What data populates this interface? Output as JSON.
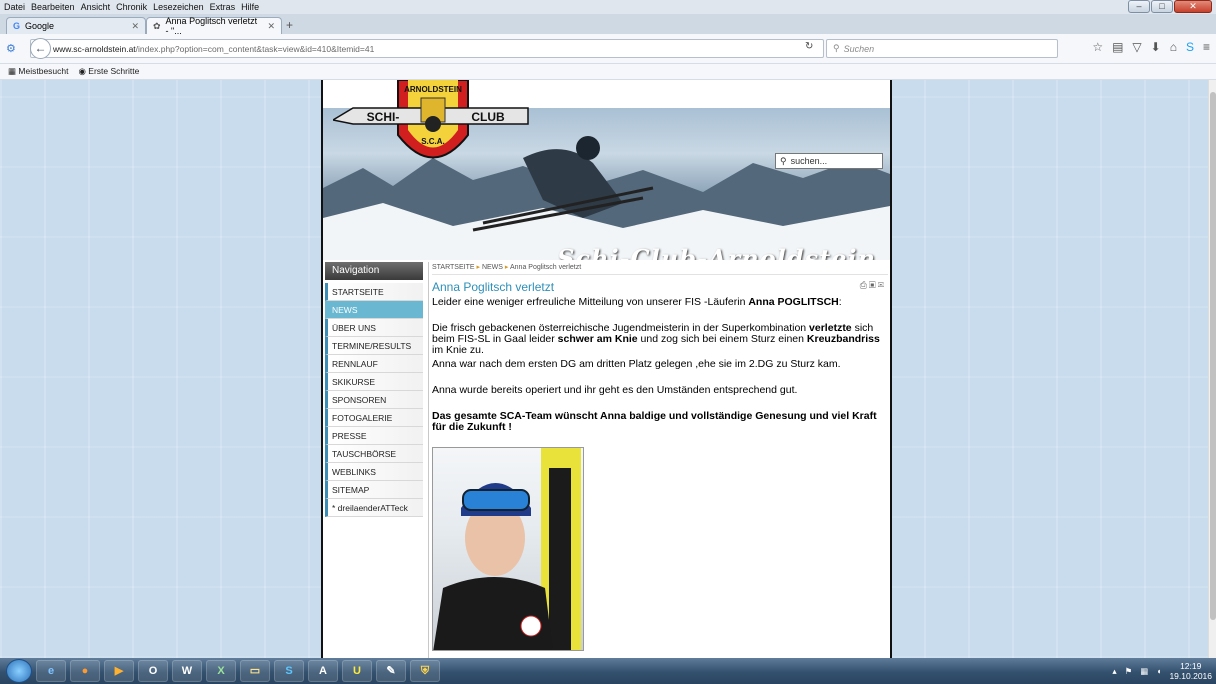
{
  "browser": {
    "menu": [
      "Datei",
      "Bearbeiten",
      "Ansicht",
      "Chronik",
      "Lesezeichen",
      "Extras",
      "Hilfe"
    ],
    "tabs": [
      {
        "label": "Google"
      },
      {
        "label": "Anna Poglitsch verletzt - \"..."
      }
    ],
    "url_host": "www.sc-arnoldstein.at",
    "url_path": "/index.php?option=com_content&task=view&id=410&Itemid=41",
    "search_placeholder": "Suchen",
    "bookmarks": [
      "Meistbesucht",
      "Erste Schritte"
    ]
  },
  "site": {
    "logo_top": "ARNOLDSTEIN",
    "logo_left": "SCHI-",
    "logo_right": "CLUB",
    "logo_bottom": "S.C.A.",
    "title": "Schi-Club-Arnoldstein",
    "search_placeholder": "suchen...",
    "nav_header": "Navigation",
    "nav_items": [
      "STARTSEITE",
      "NEWS",
      "ÜBER UNS",
      "TERMINE/RESULTS",
      "RENNLAUF",
      "SKIKURSE",
      "SPONSOREN",
      "FOTOGALERIE",
      "PRESSE",
      "TAUSCHBÖRSE",
      "WEBLINKS",
      "SITEMAP",
      "* dreilaenderATTeck"
    ],
    "breadcrumb": [
      "STARTSEITE",
      "NEWS",
      "Anna Poglitsch verletzt"
    ]
  },
  "article": {
    "title": "Anna Poglitsch verletzt",
    "intro_pre": "Leider eine weniger erfreuliche Mitteilung von unserer FIS -Läuferin ",
    "intro_name": "Anna POGLITSCH",
    "intro_post": ":",
    "p2_a": "Die frisch gebackenen österreichische Jugendmeisterin in der Superkombination ",
    "p2_b": "verletzte",
    "p2_c": " sich beim FIS-SL in Gaal leider ",
    "p2_d": "schwer am Knie",
    "p2_e": " und zog sich bei einem Sturz einen ",
    "p2_f": "Kreuzbandriss",
    "p2_g": " im Knie zu.",
    "p3": "Anna war nach dem ersten DG am dritten Platz gelegen ,ehe sie im 2.DG zu Sturz kam.",
    "p4": "Anna wurde bereits operiert und ihr geht es den Umständen entsprechend gut.",
    "p5": "Das gesamte SCA-Team wünscht Anna baldige und vollständige Genesung und viel Kraft für die Zukunft !"
  },
  "taskbar": {
    "time": "12:19",
    "date": "19.10.2016"
  }
}
